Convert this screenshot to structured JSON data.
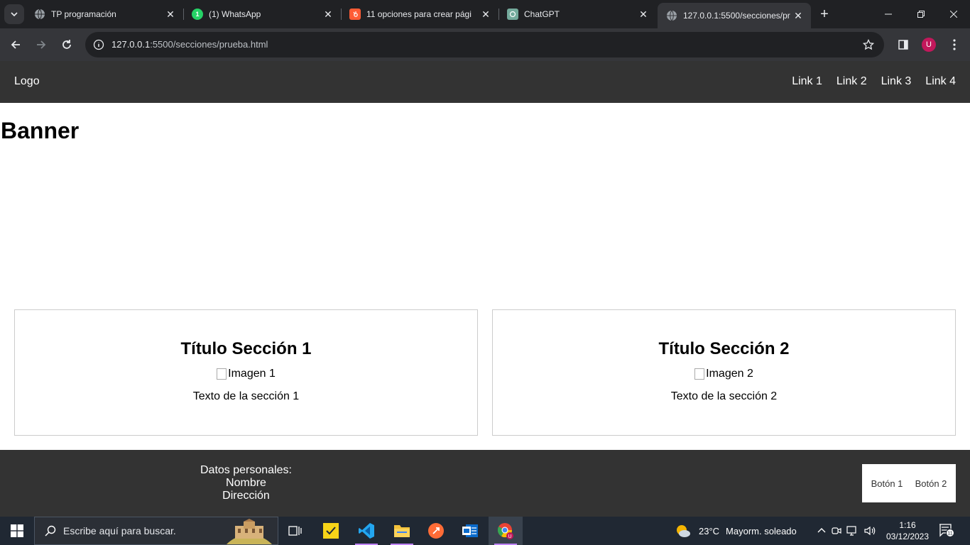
{
  "browser": {
    "tabs": [
      {
        "title": "TP programación",
        "favicon": "globe-icon"
      },
      {
        "title": "(1) WhatsApp",
        "favicon": "whatsapp-icon"
      },
      {
        "title": "11 opciones para crear pági",
        "favicon": "hubspot-icon"
      },
      {
        "title": "ChatGPT",
        "favicon": "chatgpt-icon"
      },
      {
        "title": "127.0.0.1:5500/secciones/pr",
        "favicon": "globe-icon",
        "active": true
      }
    ],
    "url_host": "127.0.0.1",
    "url_path": ":5500/secciones/prueba.html",
    "profile_initial": "U"
  },
  "page": {
    "logo_alt": "Logo",
    "nav_links": [
      "Link 1",
      "Link 2",
      "Link 3",
      "Link 4"
    ],
    "banner_title": "Banner",
    "sections": [
      {
        "title": "Título Sección 1",
        "image_alt": "Imagen 1",
        "text": "Texto de la sección 1"
      },
      {
        "title": "Título Sección 2",
        "image_alt": "Imagen 2",
        "text": "Texto de la sección 2"
      }
    ],
    "footer": {
      "lines": [
        "Datos personales:",
        "Nombre",
        "Dirección"
      ],
      "buttons": [
        "Botón 1",
        "Botón 2"
      ]
    }
  },
  "taskbar": {
    "search_placeholder": "Escribe aquí para buscar.",
    "weather_temp": "23°C",
    "weather_text": "Mayorm. soleado",
    "time": "1:16",
    "date": "03/12/2023",
    "notification_count": "11"
  },
  "colors": {
    "nav_bg": "#333333",
    "tab_bg": "#202124",
    "toolbar_bg": "#35363a"
  }
}
